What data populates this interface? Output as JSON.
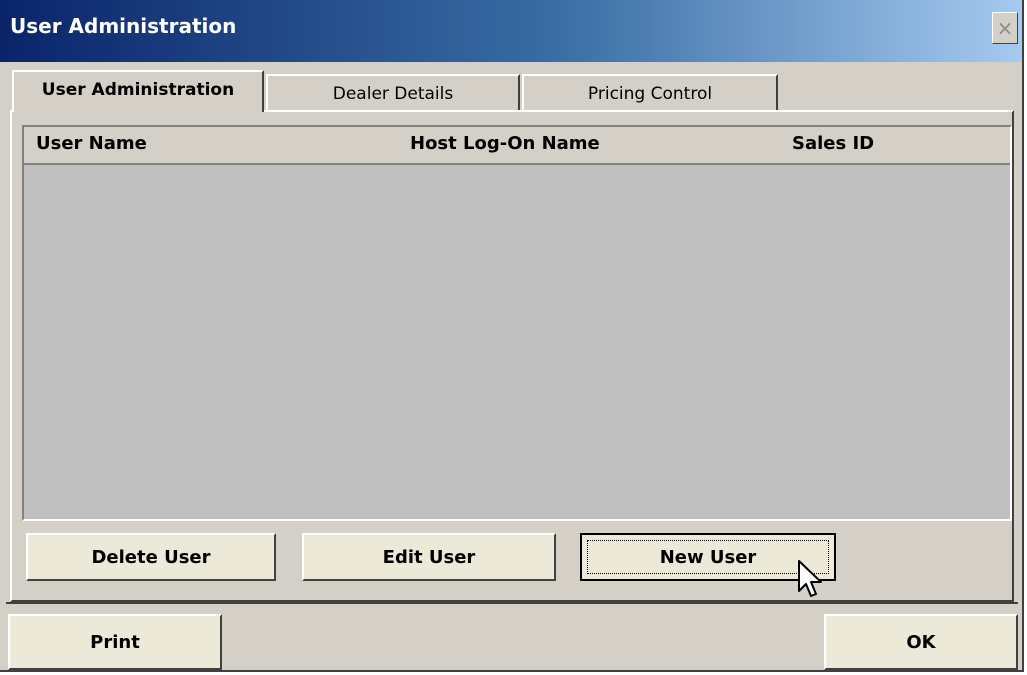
{
  "window": {
    "title": "User Administration",
    "close_label": "×"
  },
  "tabs": [
    {
      "label": "User Administration",
      "active": true
    },
    {
      "label": "Dealer Details",
      "active": false
    },
    {
      "label": "Pricing Control",
      "active": false
    }
  ],
  "user_list": {
    "columns": [
      "User Name",
      "Host Log-On Name",
      "Sales ID"
    ],
    "rows": []
  },
  "actions": {
    "delete_label": "Delete User",
    "edit_label": "Edit User",
    "new_label": "New User"
  },
  "footer": {
    "print_label": "Print",
    "ok_label": "OK"
  },
  "colors": {
    "titlebar_start": "#0a246a",
    "titlebar_end": "#a6caf0",
    "face": "#d4d0c8",
    "list_background": "#c0c0c0"
  },
  "icons": [
    "close-icon",
    "mouse-pointer-icon"
  ]
}
